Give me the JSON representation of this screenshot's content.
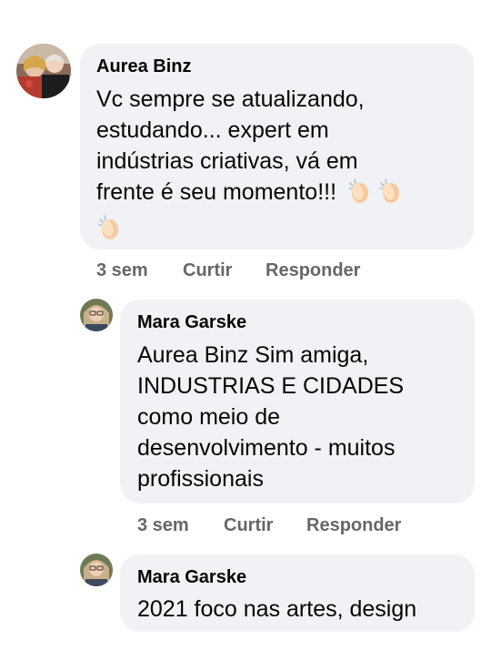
{
  "comments": [
    {
      "author": "Aurea Binz",
      "lines": [
        "Vc sempre se atualizando,",
        "estudando... expert em",
        "indústrias criativas, vá em",
        "frente é seu momento!!!"
      ],
      "emoji": "clapping-hands",
      "time": "3 sem",
      "like_label": "Curtir",
      "reply_label": "Responder"
    },
    {
      "author": "Mara Garske",
      "lines": [
        "Aurea Binz Sim amiga,",
        "INDUSTRIAS E CIDADES",
        "como meio de",
        "desenvolvimento - muitos",
        "profissionais"
      ],
      "time": "3 sem",
      "like_label": "Curtir",
      "reply_label": "Responder"
    },
    {
      "author": "Mara Garske",
      "lines": [
        "2021 foco nas artes, design"
      ]
    }
  ],
  "colors": {
    "bubble": "#f0f2f5",
    "text": "#050505",
    "secondary_text": "#65676b"
  }
}
